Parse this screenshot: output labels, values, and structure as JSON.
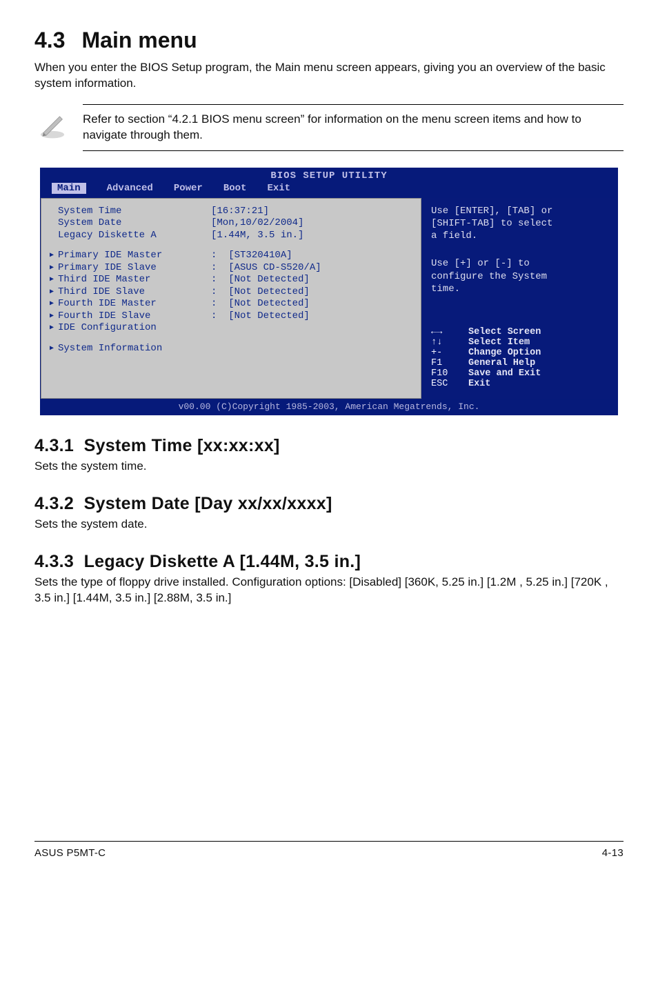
{
  "heading": {
    "number": "4.3",
    "title": "Main menu"
  },
  "intro": "When you enter the BIOS Setup program, the Main menu screen appears, giving you an overview of the basic system information.",
  "note": "Refer to section “4.2.1  BIOS menu screen” for information on the menu screen items and how to navigate through them.",
  "bios": {
    "title": "BIOS SETUP UTILITY",
    "menus": [
      "Main",
      "Advanced",
      "Power",
      "Boot",
      "Exit"
    ],
    "selected_menu": "Main",
    "left": {
      "rows1": [
        {
          "label": "System Time",
          "value": "[16:37:21]"
        },
        {
          "label": "System Date",
          "value": "[Mon,10/02/2004]"
        },
        {
          "label": "Legacy Diskette A",
          "value": "[1.44M, 3.5 in.]"
        }
      ],
      "rows2": [
        {
          "label": "Primary IDE Master",
          "value": "[ST320410A]"
        },
        {
          "label": "Primary IDE Slave",
          "value": "[ASUS CD-S520/A]"
        },
        {
          "label": "Third IDE Master",
          "value": "[Not Detected]"
        },
        {
          "label": "Third IDE Slave",
          "value": "[Not Detected]"
        },
        {
          "label": "Fourth IDE Master",
          "value": "[Not Detected]"
        },
        {
          "label": "Fourth IDE Slave",
          "value": "[Not Detected]"
        },
        {
          "label": "IDE Configuration",
          "value": ""
        }
      ],
      "rows3": [
        {
          "label": "System Information",
          "value": ""
        }
      ]
    },
    "right": {
      "help1a": "Use [ENTER], [TAB] or",
      "help1b": "[SHIFT-TAB] to select",
      "help1c": "a field.",
      "help2a": "Use [+] or [-] to",
      "help2b": "configure the System",
      "help2c": "time.",
      "keys": [
        {
          "k": "←→",
          "d": "Select Screen"
        },
        {
          "k": "↑↓",
          "d": "Select Item"
        },
        {
          "k": "+-",
          "d": "Change Option"
        },
        {
          "k": "F1",
          "d": "General Help"
        },
        {
          "k": "F10",
          "d": "Save and Exit"
        },
        {
          "k": "ESC",
          "d": "Exit"
        }
      ]
    },
    "footer": "v00.00 (C)Copyright 1985-2003, American Megatrends, Inc."
  },
  "sub1": {
    "num": "4.3.1",
    "title": "System Time [xx:xx:xx]",
    "body": "Sets the system time."
  },
  "sub2": {
    "num": "4.3.2",
    "title": "System Date [Day xx/xx/xxxx]",
    "body": "Sets the system date."
  },
  "sub3": {
    "num": "4.3.3",
    "title": "Legacy Diskette A [1.44M, 3.5 in.]",
    "body": "Sets the type of floppy drive installed. Configuration options: [Disabled] [360K, 5.25 in.] [1.2M , 5.25 in.] [720K , 3.5 in.] [1.44M, 3.5 in.] [2.88M, 3.5 in.]"
  },
  "footer": {
    "left": "ASUS P5MT-C",
    "right": "4-13"
  }
}
